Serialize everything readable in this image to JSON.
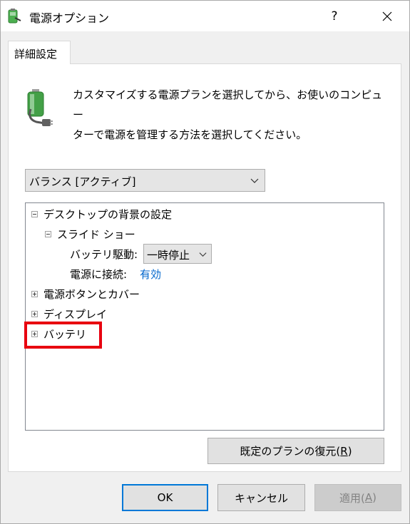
{
  "window": {
    "title": "電源オプション",
    "help_label": "?",
    "icon": "power-options-icon"
  },
  "tab": {
    "label": "詳細設定"
  },
  "description": {
    "line1": "カスタマイズする電源プランを選択してから、お使いのコンピュー",
    "line2": "ターで電源を管理する方法を選択してください。"
  },
  "plan_select": {
    "value": "バランス [アクティブ]"
  },
  "tree": {
    "desktop_background": "デスクトップの背景の設定",
    "slideshow": "スライド ショー",
    "on_battery_label": "バッテリ駆動:",
    "on_battery_value": "一時停止",
    "plugged_in_label": "電源に接続:",
    "plugged_in_value": "有効",
    "power_buttons": "電源ボタンとカバー",
    "display": "ディスプレイ",
    "battery": "バッテリ"
  },
  "buttons": {
    "restore_text": "既定のプランの復元(",
    "restore_key": "R",
    "restore_end": ")",
    "ok": "OK",
    "cancel": "キャンセル",
    "apply_text": "適用(",
    "apply_key": "A",
    "apply_end": ")"
  },
  "colors": {
    "highlight": "#e8000f",
    "link": "#0066cc",
    "focus": "#0078d7"
  }
}
